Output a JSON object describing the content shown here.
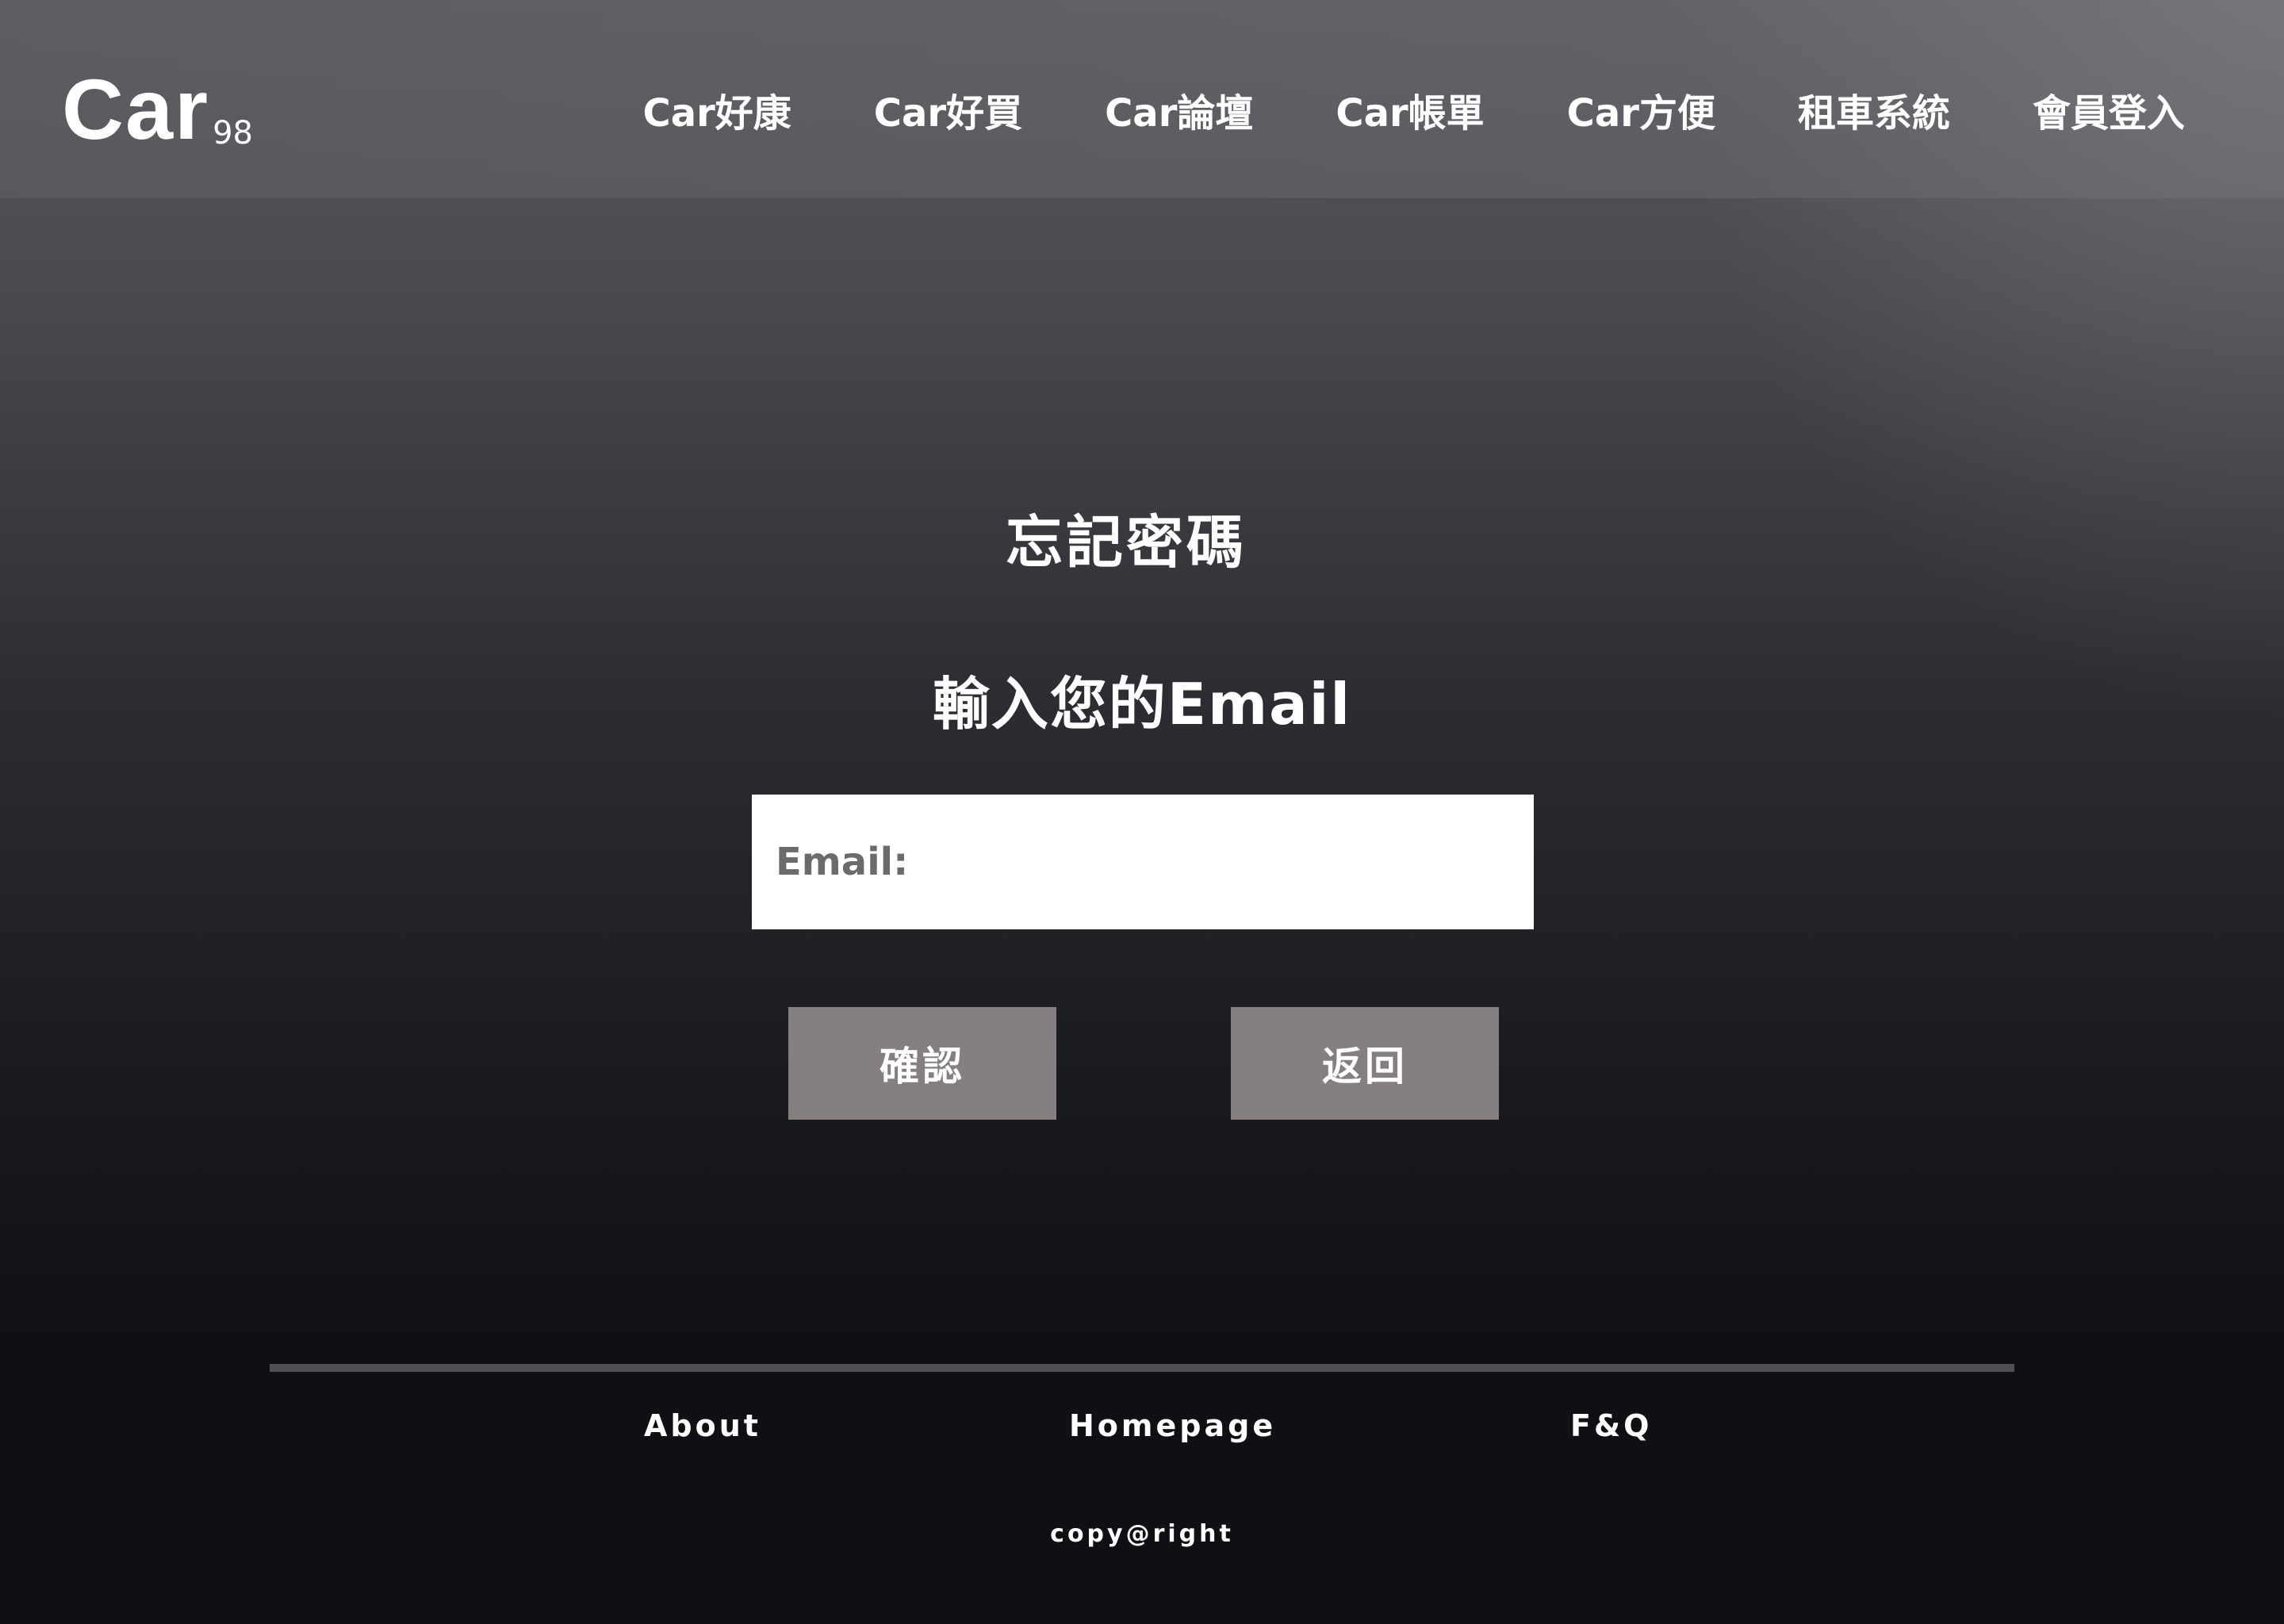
{
  "brand": {
    "logo_main": "Car",
    "logo_sub": "98"
  },
  "nav": {
    "items": [
      {
        "label": "Car好康"
      },
      {
        "label": "Car好買"
      },
      {
        "label": "Car論壇"
      },
      {
        "label": "Car帳單"
      },
      {
        "label": "Car方便"
      },
      {
        "label": "租車系統"
      },
      {
        "label": "會員登入"
      }
    ]
  },
  "main": {
    "title": "忘記密碼",
    "subtitle": "輸入您的Email",
    "email_placeholder": "Email:",
    "email_value": "",
    "confirm_label": "確認",
    "back_label": "返回"
  },
  "footer": {
    "about_label": "About",
    "homepage_label": "Homepage",
    "faq_label": "F&Q",
    "copyright": "copy@right"
  }
}
